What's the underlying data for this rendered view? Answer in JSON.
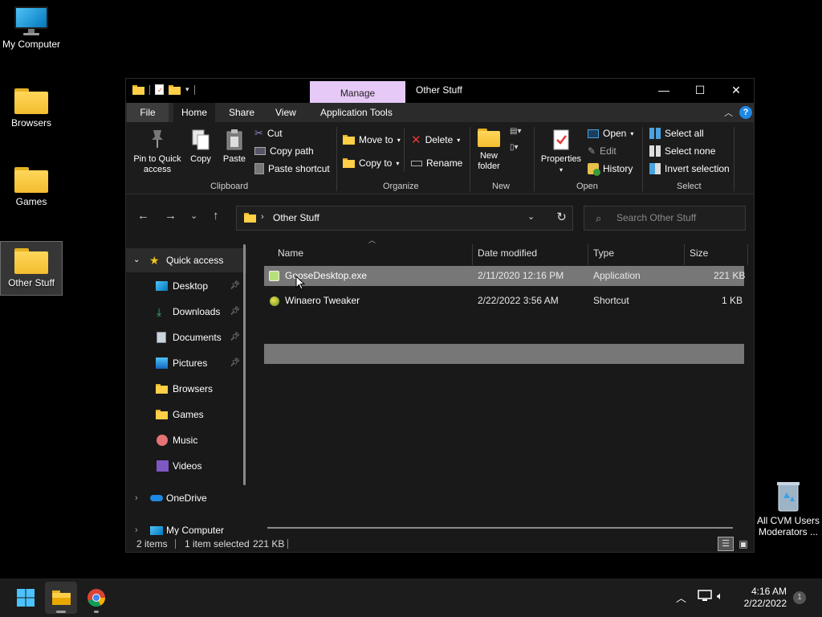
{
  "desktop": {
    "icons": [
      {
        "label": "My Computer",
        "type": "monitor"
      },
      {
        "label": "Browsers",
        "type": "folder"
      },
      {
        "label": "Games",
        "type": "folder"
      },
      {
        "label": "Other Stuff",
        "type": "folder",
        "selected": true
      }
    ],
    "recycle_bin": {
      "label_line1": "All CVM Users",
      "label_line2": "Moderators ..."
    }
  },
  "window": {
    "title": "Other Stuff",
    "context_tab": "Manage",
    "tabs": [
      "File",
      "Home",
      "Share",
      "View",
      "Application Tools"
    ],
    "active_tab": "Home",
    "ribbon": {
      "clipboard": {
        "label": "Clipboard",
        "pin_label": "Pin to Quick access",
        "copy_label": "Copy",
        "paste_label": "Paste",
        "cut_label": "Cut",
        "copy_path_label": "Copy path",
        "paste_shortcut_label": "Paste shortcut"
      },
      "organize": {
        "label": "Organize",
        "move_to_label": "Move to",
        "copy_to_label": "Copy to",
        "delete_label": "Delete",
        "rename_label": "Rename"
      },
      "new": {
        "label": "New",
        "new_folder_label": "New folder"
      },
      "open": {
        "label": "Open",
        "properties_label": "Properties",
        "open_label": "Open",
        "edit_label": "Edit",
        "history_label": "History"
      },
      "select": {
        "label": "Select",
        "select_all_label": "Select all",
        "select_none_label": "Select none",
        "invert_label": "Invert selection"
      }
    },
    "address": {
      "path": "Other Stuff"
    },
    "search": {
      "placeholder": "Search Other Stuff"
    },
    "nav": {
      "quick_access": "Quick access",
      "items": [
        {
          "label": "Desktop",
          "pinned": true
        },
        {
          "label": "Downloads",
          "pinned": true
        },
        {
          "label": "Documents",
          "pinned": true
        },
        {
          "label": "Pictures",
          "pinned": true
        },
        {
          "label": "Browsers",
          "pinned": false
        },
        {
          "label": "Games",
          "pinned": false
        },
        {
          "label": "Music",
          "pinned": false
        },
        {
          "label": "Videos",
          "pinned": false
        }
      ],
      "onedrive": "OneDrive",
      "my_computer": "My Computer"
    },
    "columns": [
      "Name",
      "Date modified",
      "Type",
      "Size"
    ],
    "files": [
      {
        "name": "GooseDesktop.exe",
        "date": "2/11/2020 12:16 PM",
        "type": "Application",
        "size": "221 KB",
        "selected": true
      },
      {
        "name": "Winaero Tweaker",
        "date": "2/22/2022 3:56 AM",
        "type": "Shortcut",
        "size": "1 KB",
        "selected": false
      }
    ],
    "status": {
      "count": "2 items",
      "selected": "1 item selected",
      "size": "221 KB"
    }
  },
  "taskbar": {
    "time": "4:16 AM",
    "date": "2/22/2022",
    "notification_count": "1"
  },
  "colors": {
    "manage_tab": "#e7c9f7",
    "folder": "#ffcf48",
    "selection": "#777777",
    "accent": "#0078d4"
  }
}
